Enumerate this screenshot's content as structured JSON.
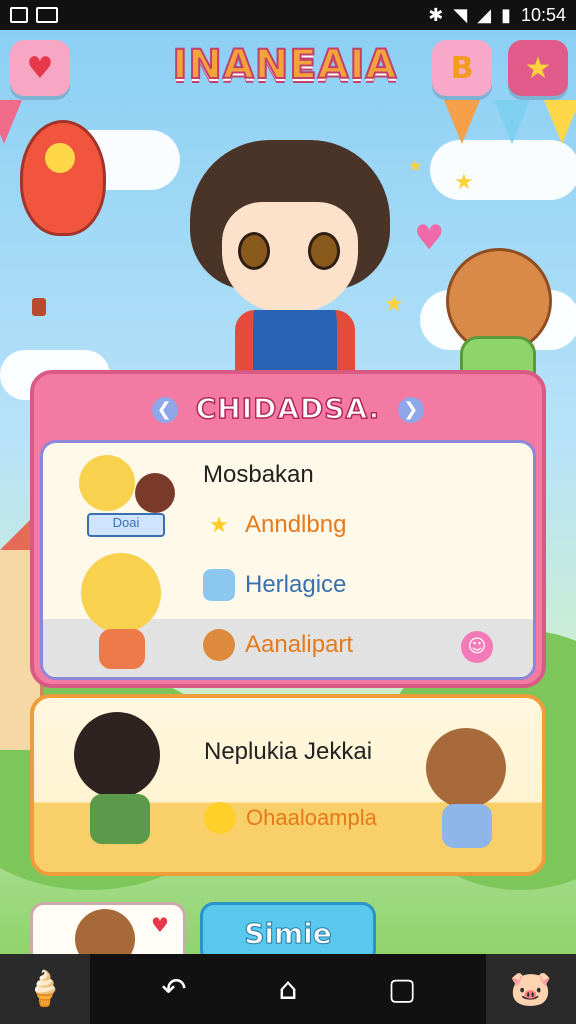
{
  "status_bar": {
    "time": "10:54",
    "bluetooth_icon": "bluetooth-icon",
    "wifi_icon": "wifi-icon",
    "signal_icon": "signal-icon",
    "battery_icon": "battery-icon"
  },
  "header": {
    "title": "INANEAIA",
    "heart_icon": "heart-icon",
    "b_label": "B",
    "star_icon": "star-icon"
  },
  "main_panel": {
    "title": "CHIDADSA.",
    "items": [
      {
        "label": "Mosbakan",
        "icon": ""
      },
      {
        "label": "Anndlbng",
        "icon": "star-icon"
      },
      {
        "label": "Herlagice",
        "icon": "bag-icon"
      },
      {
        "label": "Aanalipart",
        "icon": "pumpkin-icon"
      }
    ],
    "badge_text": "Doai"
  },
  "second_panel": {
    "name": "Neplukia Jekkai",
    "action_label": "Ohaaloampla"
  },
  "bottom": {
    "simple_button": "Simie"
  },
  "colors": {
    "panel_pink": "#f37aa3",
    "panel_orange": "#f19c3a",
    "accent_orange": "#e57a1c",
    "accent_blue": "#3a6fb0"
  }
}
